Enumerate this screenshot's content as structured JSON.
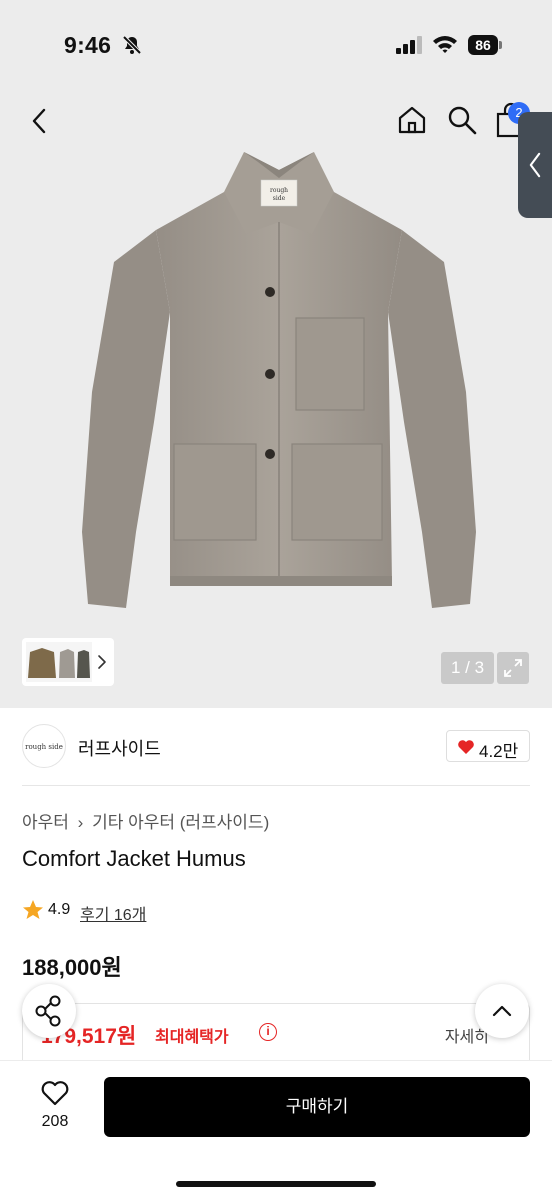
{
  "status_bar": {
    "time": "9:46",
    "battery": "86",
    "icons": [
      "bell-off-icon",
      "signal-icon",
      "wifi-icon",
      "battery-icon"
    ]
  },
  "nav": {
    "icons": [
      "back-icon",
      "home-icon",
      "search-icon",
      "shopping-bag-icon"
    ],
    "bag_badge": "2"
  },
  "gallery": {
    "counter": "1 / 3",
    "expand_icon": "expand-icon",
    "thumb_chevron_icon": "chevron-right-icon"
  },
  "brand": {
    "logo_text": "rough side",
    "name": "러프사이드",
    "likes": "4.2만",
    "like_icon": "heart-icon"
  },
  "breadcrumb": [
    "아우터",
    "기타 아우터 (러프사이드)"
  ],
  "product": {
    "title": "Comfort Jacket Humus",
    "rating": "4.9",
    "review_link": "후기 16개",
    "price": "188,000원"
  },
  "benefit": {
    "sale_price": "179,517원",
    "label": "최대혜택가",
    "detail": "자세히"
  },
  "floating": {
    "share_icon": "share-icon",
    "up_icon": "chevron-up-icon"
  },
  "bottom_bar": {
    "wish_count": "208",
    "buy_label": "구매하기"
  },
  "colors": {
    "accent_red": "#e52525",
    "badge_blue": "#2f6cf6",
    "jacket": "#a39c93"
  }
}
